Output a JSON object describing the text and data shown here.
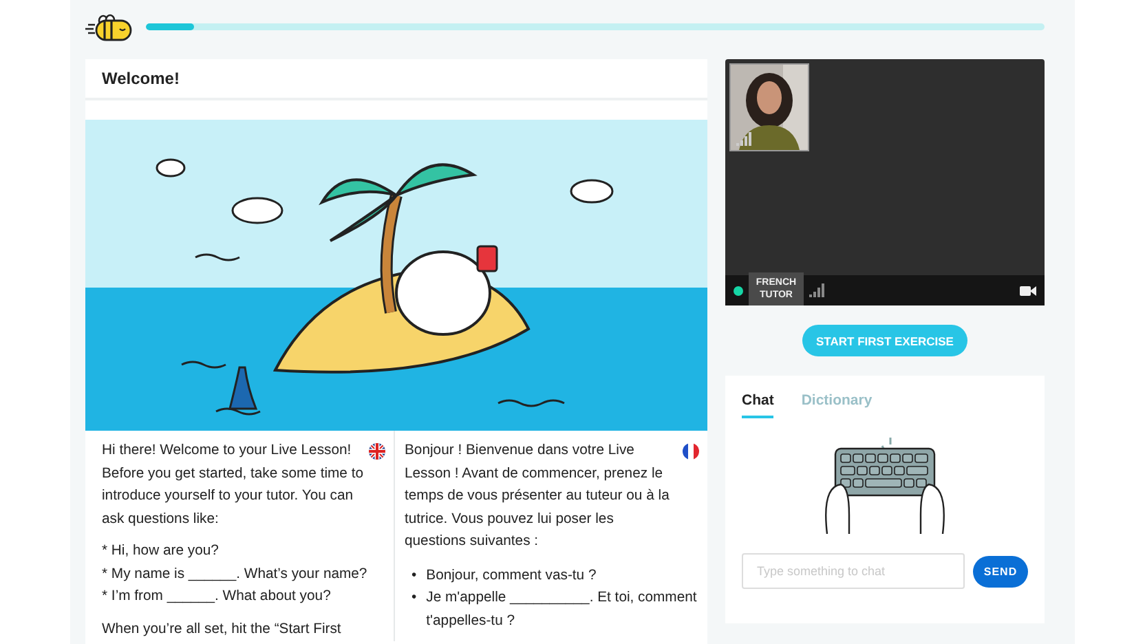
{
  "header": {
    "progress": {
      "level": 0.053
    }
  },
  "lesson": {
    "title": "Welcome!",
    "english": {
      "intro": "Hi there! Welcome to your Live Lesson! Before you get started, take some time to introduce yourself to your tutor. You can ask questions like:",
      "questions": [
        "* Hi, how are you?",
        "* My name is ______. What’s your name?",
        "* I’m from ______. What about you?"
      ],
      "closing": "When you’re all set, hit the “Start First"
    },
    "french": {
      "intro": "Bonjour ! Bienvenue dans votre Live Lesson ! Avant de commencer, prenez le temps de vous présenter au tuteur ou à la tutrice. Vous pouvez lui poser les questions suivantes :",
      "questions": [
        {
          "marker": "•",
          "text": "Bonjour, comment vas-tu ?"
        },
        {
          "marker": "•",
          "text": "Je m'appelle __________. Et toi, comment t'appelles-tu ?"
        }
      ]
    }
  },
  "video": {
    "online": true,
    "tutor_label": "FRENCH TUTOR"
  },
  "start_button": "START FIRST EXERCISE",
  "chat": {
    "tabs": [
      {
        "label": "Chat",
        "selected": true
      },
      {
        "label": "Dictionary",
        "selected": false
      }
    ],
    "input": {
      "placeholder": "Type something to chat"
    },
    "send_button": "SEND"
  }
}
